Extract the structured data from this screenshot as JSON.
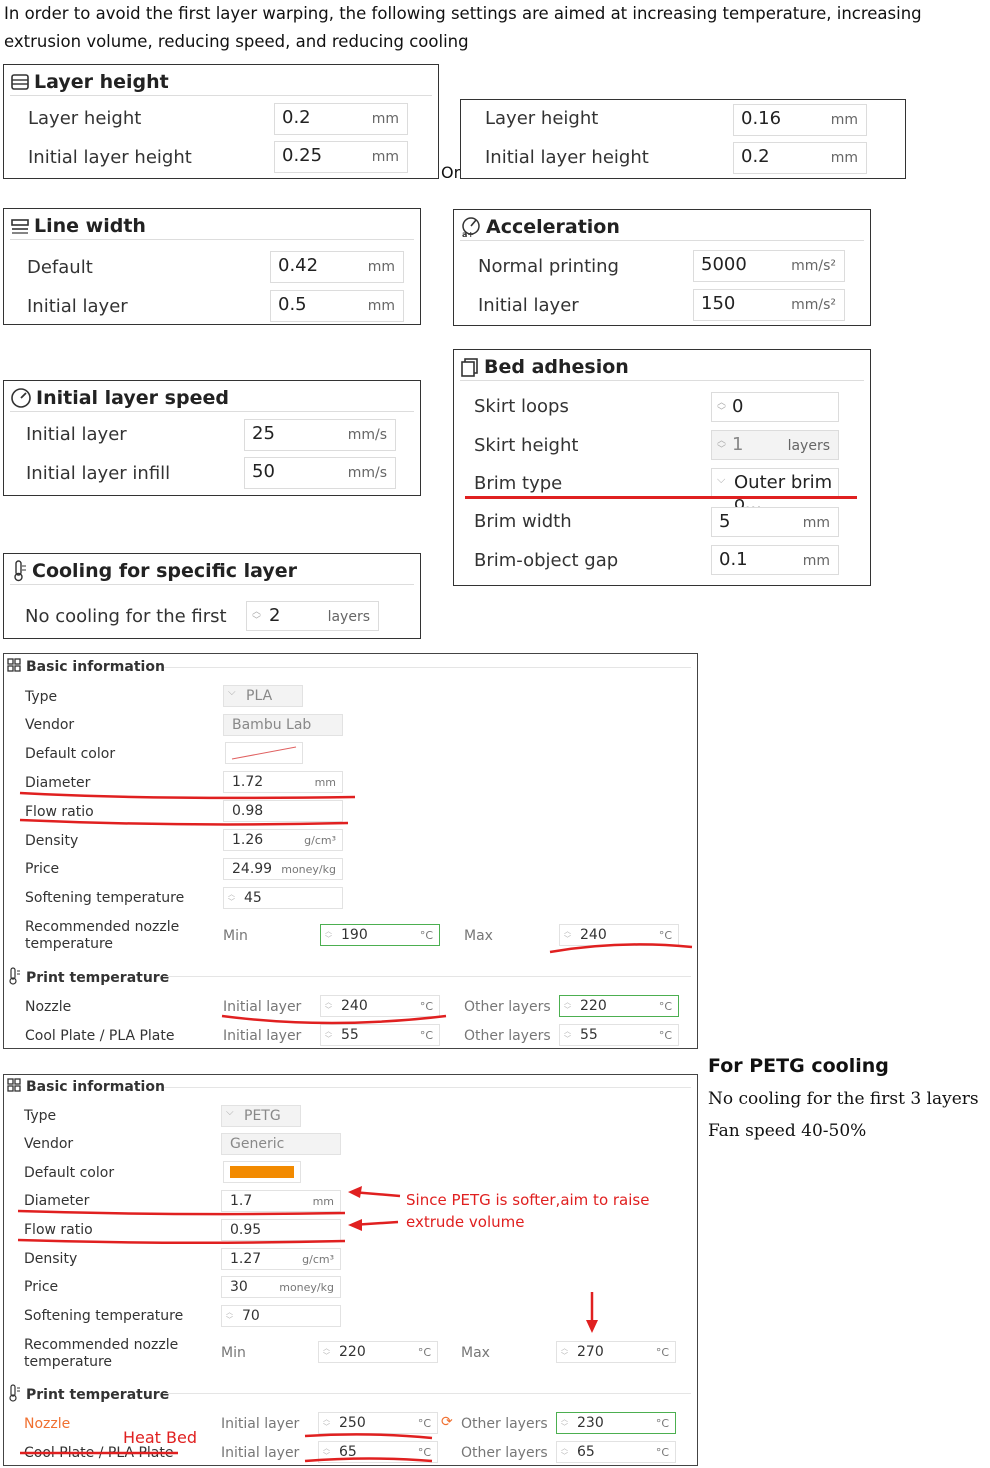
{
  "intro": {
    "text": "In order to avoid the first layer      warping, the following settings are aimed at increasing temperature, increasing extrusion volume, reducing speed, and reducing cooling"
  },
  "or_label": "Or",
  "layer_height_a": {
    "title": "Layer height",
    "rows": [
      {
        "label": "Layer height",
        "value": "0.2",
        "unit": "mm"
      },
      {
        "label": "Initial layer height",
        "value": "0.25",
        "unit": "mm"
      }
    ]
  },
  "layer_height_b": {
    "rows": [
      {
        "label": "Layer height",
        "value": "0.16",
        "unit": "mm"
      },
      {
        "label": "Initial layer height",
        "value": "0.2",
        "unit": "mm"
      }
    ]
  },
  "line_width": {
    "title": "Line width",
    "rows": [
      {
        "label": "Default",
        "value": "0.42",
        "unit": "mm"
      },
      {
        "label": "Initial layer",
        "value": "0.5",
        "unit": "mm"
      }
    ]
  },
  "acceleration": {
    "title": "Acceleration",
    "rows": [
      {
        "label": "Normal printing",
        "value": "5000",
        "unit": "mm/s²"
      },
      {
        "label": "Initial layer",
        "value": "150",
        "unit": "mm/s²"
      }
    ]
  },
  "initial_speed": {
    "title": "Initial layer speed",
    "rows": [
      {
        "label": "Initial layer",
        "value": "25",
        "unit": "mm/s"
      },
      {
        "label": "Initial layer infill",
        "value": "50",
        "unit": "mm/s"
      }
    ]
  },
  "bed_adhesion": {
    "title": "Bed adhesion",
    "rows": [
      {
        "label": "Skirt loops",
        "value": "0",
        "unit": ""
      },
      {
        "label": "Skirt height",
        "value": "1",
        "unit": "layers"
      },
      {
        "label": "Brim type",
        "value": "Outer brim o...",
        "unit": ""
      },
      {
        "label": "Brim width",
        "value": "5",
        "unit": "mm"
      },
      {
        "label": "Brim-object gap",
        "value": "0.1",
        "unit": "mm"
      }
    ]
  },
  "cooling": {
    "title": "Cooling for specific layer",
    "label": "No cooling for the first",
    "value": "2",
    "unit": "layers"
  },
  "pla": {
    "basic_title": "Basic information",
    "type_label": "Type",
    "type_value": "PLA",
    "vendor_label": "Vendor",
    "vendor_value": "Bambu Lab",
    "color_label": "Default color",
    "diameter_label": "Diameter",
    "diameter_value": "1.72",
    "diameter_unit": "mm",
    "flow_label": "Flow ratio",
    "flow_value": "0.98",
    "density_label": "Density",
    "density_value": "1.26",
    "density_unit": "g/cm³",
    "price_label": "Price",
    "price_value": "24.99",
    "price_unit": "money/kg",
    "soft_label": "Softening temperature",
    "soft_value": "45",
    "nozzle_rec_label1": "Recommended nozzle",
    "nozzle_rec_label2": "temperature",
    "min_label": "Min",
    "min_value": "190",
    "max_label": "Max",
    "max_value": "240",
    "deg": "°C",
    "print_title": "Print temperature",
    "nozzle_label": "Nozzle",
    "init_label": "Initial layer",
    "nozzle_init": "240",
    "other_label": "Other layers",
    "nozzle_other": "220",
    "plate_label": "Cool Plate / PLA Plate",
    "plate_init": "55",
    "plate_other": "55"
  },
  "petg_notes": {
    "title": "For PETG cooling",
    "line1": "No cooling for the first 3 layers",
    "line2": "Fan speed 40-50%"
  },
  "petg": {
    "basic_title": "Basic information",
    "type_label": "Type",
    "type_value": "PETG",
    "vendor_label": "Vendor",
    "vendor_value": "Generic",
    "color_label": "Default color",
    "color": "#f28a00",
    "diameter_label": "Diameter",
    "diameter_value": "1.7",
    "diameter_unit": "mm",
    "flow_label": "Flow ratio",
    "flow_value": "0.95",
    "density_label": "Density",
    "density_value": "1.27",
    "density_unit": "g/cm³",
    "price_label": "Price",
    "price_value": "30",
    "price_unit": "money/kg",
    "soft_label": "Softening temperature",
    "soft_value": "70",
    "nozzle_rec_label1": "Recommended nozzle",
    "nozzle_rec_label2": "temperature",
    "min_label": "Min",
    "min_value": "220",
    "max_label": "Max",
    "max_value": "270",
    "deg": "°C",
    "print_title": "Print temperature",
    "nozzle_label": "Nozzle",
    "init_label": "Initial layer",
    "nozzle_init": "250",
    "other_label": "Other layers",
    "nozzle_other": "230",
    "plate_label": "Cool Plate / PLA Plate",
    "plate_init": "65",
    "plate_other": "65",
    "note1": "Since PETG is softer,aim to raise",
    "note2": "extrude volume",
    "heat_bed": "Heat Bed"
  },
  "colors": {
    "annotation_red": "#e02020",
    "valid_green": "#4caf50",
    "petg_orange": "#f28a00"
  }
}
